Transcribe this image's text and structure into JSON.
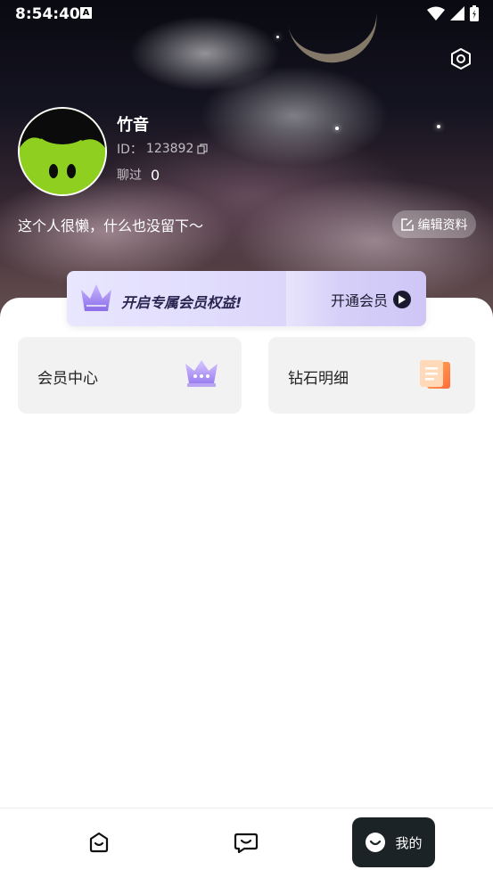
{
  "status_bar": {
    "time": "8:54:40",
    "notification_letter": "A"
  },
  "profile": {
    "username": "竹音",
    "id_label": "ID：",
    "id_value": "123892",
    "chat_label": "聊过",
    "chat_count": "0",
    "bio": "这个人很懒，什么也没留下～",
    "edit_label": "编辑资料"
  },
  "vip_banner": {
    "text": "开启专属会员权益!",
    "cta": "开通会员"
  },
  "cards": [
    {
      "label": "会员中心",
      "icon": "crown-icon"
    },
    {
      "label": "钻石明细",
      "icon": "clipboard-icon"
    }
  ],
  "tabbar": {
    "items": [
      {
        "icon": "home-face-icon"
      },
      {
        "icon": "message-face-icon"
      },
      {
        "icon": "mine-face-icon",
        "label": "我的",
        "active": true
      }
    ]
  },
  "colors": {
    "accent_dark": "#1c2326",
    "banner_purple": "#ddd8fb",
    "card_bg": "#f2f2f2",
    "avatar_green": "#8ecf20"
  }
}
